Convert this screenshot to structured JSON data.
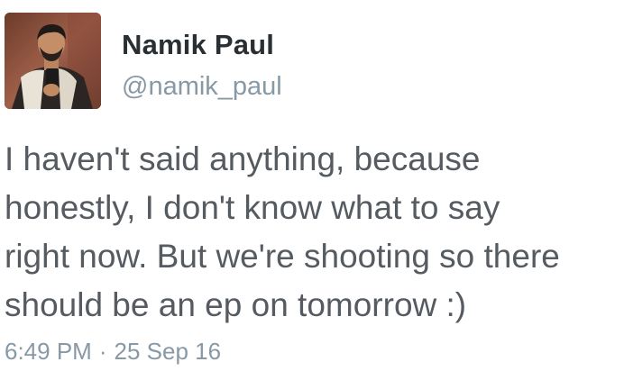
{
  "author": {
    "display_name": "Namik Paul",
    "handle": "@namik_paul",
    "avatar_icon": "user-photo-avatar"
  },
  "tweet": {
    "text": "I haven't said anything, because\nhonestly, I don't know what to say\nright now. But we're shooting so there\nshould be an ep on tomorrow :)",
    "time": "6:49 PM",
    "separator": "·",
    "date": "25 Sep 16"
  },
  "colors": {
    "name": "#292f33",
    "handle": "#8899a6",
    "body_text": "#555b61",
    "background": "#ffffff"
  }
}
